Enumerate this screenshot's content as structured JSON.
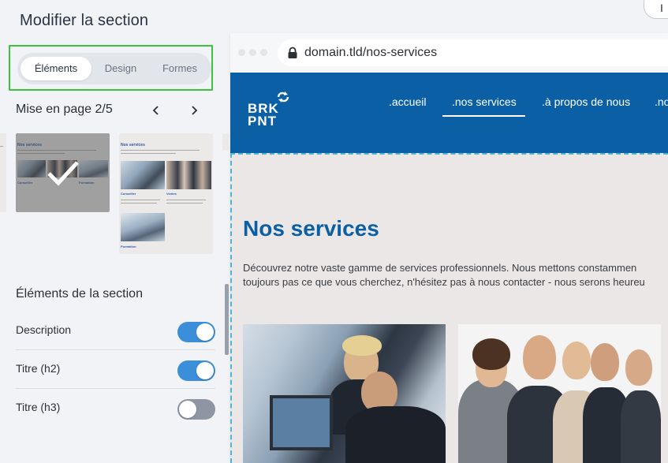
{
  "panel": {
    "title": "Modifier la section",
    "tabs": [
      {
        "label": "Éléments",
        "active": true
      },
      {
        "label": "Design",
        "active": false
      },
      {
        "label": "Formes",
        "active": false
      }
    ],
    "layout_label": "Mise en page 2/5",
    "thumbnails": {
      "title": "Nos services",
      "captions": [
        "Conseiller",
        "Formation",
        "Ventes"
      ]
    },
    "section_elements_heading": "Éléments de la section",
    "toggles": [
      {
        "label": "Description",
        "state": "on"
      },
      {
        "label": "Titre (h2)",
        "state": "on"
      },
      {
        "label": "Titre (h3)",
        "state": "off"
      }
    ],
    "top_right_button": "I"
  },
  "browser": {
    "url": "domain.tld/nos-services"
  },
  "site": {
    "logo_line1": "BRK",
    "logo_line2": "PNT",
    "nav": [
      ".accueil",
      ".nos services",
      ".à propos de nous",
      ".no"
    ],
    "heading": "Nos services",
    "paragraph_line1": "Découvrez notre vaste gamme de services professionnels. Nous mettons constammen",
    "paragraph_line2": "toujours pas ce que vous cherchez, n'hésitez pas à nous contacter - nous serons heureu"
  },
  "colors": {
    "accent": "#3b8fd9",
    "brand_blue": "#0b5fa5",
    "focus_green": "#3ec13e",
    "dashed_outline": "#4bb7d8"
  },
  "icons": {
    "prev": "chevron-left-icon",
    "next": "chevron-right-icon",
    "lock": "lock-icon",
    "check": "checkmark-icon",
    "logo": "refresh-arrows-icon"
  }
}
